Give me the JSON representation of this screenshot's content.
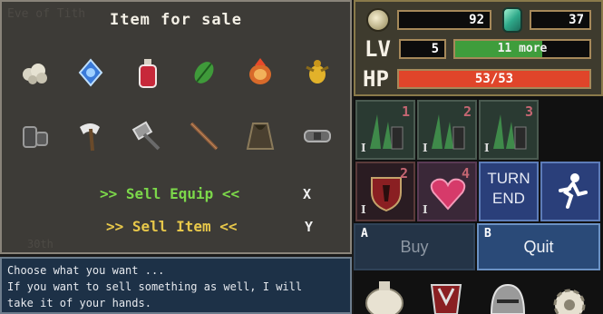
{
  "shop": {
    "title": "Item for sale",
    "ghost_top": "Eve of Tith",
    "ghost_bottom": "30th",
    "items_row1": [
      "dust-pile-icon",
      "blue-crystal-icon",
      "red-potion-icon",
      "green-leaf-icon",
      "fire-shell-icon",
      "gold-bug-icon"
    ],
    "items_row2": [
      "iron-gauntlet-icon",
      "axe-icon",
      "hammer-icon",
      "staff-icon",
      "cloak-icon",
      "belt-icon"
    ],
    "sell_equip": ">> Sell Equip <<",
    "sell_item": ">> Sell Item <<",
    "key_equip": "X",
    "key_item": "Y"
  },
  "dialog": {
    "line1": "Choose what you want ...",
    "line2": "If you want to sell something as well, I will",
    "line3": "take it of your hands."
  },
  "status": {
    "gold": "92",
    "gems": "37",
    "lv_label": "LV",
    "level": "5",
    "xp_text": "11 more",
    "xp_fraction": 0.65,
    "hp_label": "HP",
    "hp_text": "53/53",
    "hp_fraction": 1.0
  },
  "cards": {
    "skills": [
      {
        "num": "1",
        "roman": "I"
      },
      {
        "num": "2",
        "roman": "I"
      },
      {
        "num": "3",
        "roman": "I"
      }
    ],
    "shield_num": "2",
    "shield_roman": "I",
    "heart_num": "4",
    "heart_roman": "I",
    "turn_end": "TURN\nEND"
  },
  "buttons": {
    "buy_key": "A",
    "buy": "Buy",
    "quit_key": "B",
    "quit": "Quit"
  },
  "colors": {
    "equip_text": "#7cd84a",
    "item_text": "#e8c84a",
    "hp_fill": "#e0452a",
    "xp_fill": "#3f9d3c"
  }
}
